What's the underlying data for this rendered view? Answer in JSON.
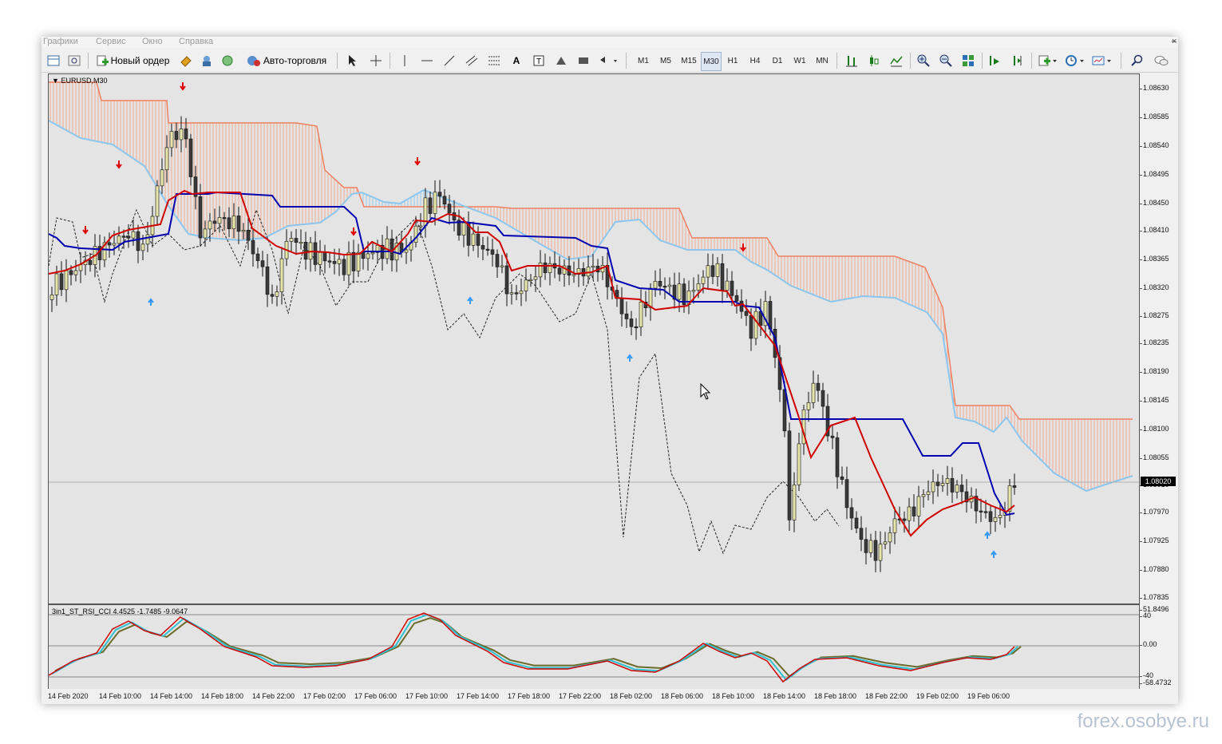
{
  "menu": {
    "items": [
      "Графики",
      "Сервис",
      "Окно",
      "Справка"
    ]
  },
  "toolbar": {
    "new_order_label": "Новый ордер",
    "autotrade_label": "Авто-торговля",
    "timeframes": [
      "M1",
      "M5",
      "M15",
      "M30",
      "H1",
      "H4",
      "D1",
      "W1",
      "MN"
    ],
    "active_timeframe": "M30"
  },
  "chart": {
    "title": "EURUSD,M30",
    "price_labels": [
      "1.08630",
      "1.08585",
      "1.08540",
      "1.08495",
      "1.08450",
      "1.08410",
      "1.08365",
      "1.08320",
      "1.08275",
      "1.08235",
      "1.08190",
      "1.08145",
      "1.08100",
      "1.08055",
      "1.08010",
      "1.07970",
      "1.07925",
      "1.07880",
      "1.07835"
    ],
    "current_price": "1.08020",
    "time_labels": [
      "14 Feb 2020",
      "14 Feb 10:00",
      "14 Feb 14:00",
      "14 Feb 18:00",
      "14 Feb 22:00",
      "17 Feb 02:00",
      "17 Feb 06:00",
      "17 Feb 10:00",
      "17 Feb 14:00",
      "17 Feb 18:00",
      "17 Feb 22:00",
      "18 Feb 02:00",
      "18 Feb 06:00",
      "18 Feb 10:00",
      "18 Feb 14:00",
      "18 Feb 18:00",
      "18 Feb 22:00",
      "19 Feb 02:00",
      "19 Feb 06:00"
    ]
  },
  "indicator": {
    "title": "3in1_ST_RSI_CCI 4.4525 -1.7485 -9.0647",
    "scale_labels": [
      "51.8496",
      "40",
      "0.00",
      "-40",
      "-58.4732"
    ]
  },
  "colors": {
    "chart_bg": "#e4e4e4",
    "bull_candle": "#e6e6a8",
    "bear_candle": "#3a3a3a",
    "kumo": "#f4a07c",
    "senkou_b": "#f08060",
    "senkou_a": "#8cc6ee",
    "tenkan": "#d00000",
    "kijun": "#0000b0",
    "up_arrow": "#3399ff",
    "down_arrow": "#e00000"
  },
  "watermark": "forex.osobye.ru"
}
